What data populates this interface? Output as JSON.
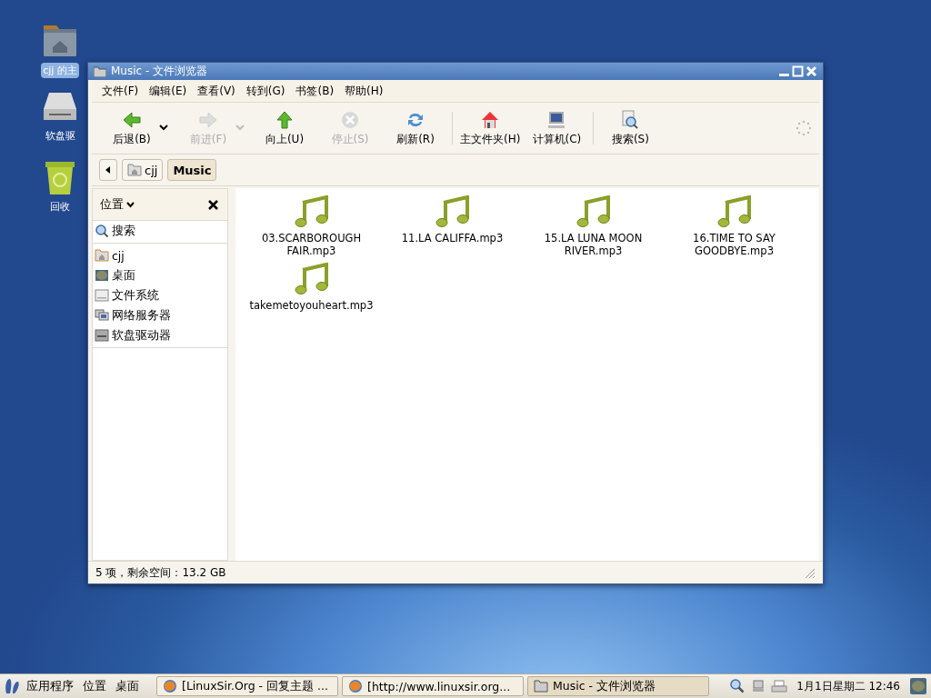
{
  "desktop": {
    "icons": [
      {
        "label": "cjj 的主",
        "selected": true
      },
      {
        "label": "软盘驱",
        "selected": false
      },
      {
        "label": "回收",
        "selected": false
      }
    ]
  },
  "window": {
    "title": "Music - 文件浏览器"
  },
  "menu": [
    "文件(F)",
    "编辑(E)",
    "查看(V)",
    "转到(G)",
    "书签(B)",
    "帮助(H)"
  ],
  "toolbar": [
    {
      "kind": "button",
      "label": "后退(B)",
      "disabled": false,
      "dropdown": true
    },
    {
      "kind": "button",
      "label": "前进(F)",
      "disabled": true,
      "dropdown": true
    },
    {
      "kind": "button",
      "label": "向上(U)",
      "disabled": false,
      "dropdown": false
    },
    {
      "kind": "button",
      "label": "停止(S)",
      "disabled": true,
      "dropdown": false
    },
    {
      "kind": "button",
      "label": "刷新(R)",
      "disabled": false,
      "dropdown": false
    },
    {
      "kind": "separator"
    },
    {
      "kind": "button",
      "label": "主文件夹(H)",
      "disabled": false,
      "dropdown": false
    },
    {
      "kind": "button",
      "label": "计算机(C)",
      "disabled": false,
      "dropdown": false
    },
    {
      "kind": "separator"
    },
    {
      "kind": "button",
      "label": "搜索(S)",
      "disabled": false,
      "dropdown": false
    }
  ],
  "path": [
    {
      "label": "cjj",
      "selected": false
    },
    {
      "label": "Music",
      "selected": true
    }
  ],
  "sidebar": {
    "title": "位置",
    "items": [
      {
        "kind": "search",
        "label": "搜索"
      },
      {
        "kind": "separator"
      },
      {
        "kind": "home",
        "label": "cjj"
      },
      {
        "kind": "desktop",
        "label": "桌面"
      },
      {
        "kind": "drive",
        "label": "文件系统"
      },
      {
        "kind": "network",
        "label": "网络服务器"
      },
      {
        "kind": "floppy",
        "label": "软盘驱动器"
      },
      {
        "kind": "separator"
      }
    ]
  },
  "files": [
    "03.SCARBOROUGH FAIR.mp3",
    "11.LA CALIFFA.mp3",
    "15.LA LUNA MOON RIVER.mp3",
    "16.TIME TO SAY GOODBYE.mp3",
    "takemetoyouheart.mp3"
  ],
  "status_bar": "5 项，剩余空间：13.2 GB",
  "taskbar": {
    "menus": [
      "应用程序",
      "位置",
      "桌面"
    ],
    "tasks": [
      {
        "label": "[LinuxSir.Org - 回复主题 ...",
        "kind": "browser",
        "selected": false
      },
      {
        "label": "[http://www.linuxsir.org...",
        "kind": "browser",
        "selected": false
      },
      {
        "label": "Music - 文件浏览器",
        "kind": "folder",
        "selected": true
      }
    ],
    "clock": "1月1日星期二 12:46"
  }
}
